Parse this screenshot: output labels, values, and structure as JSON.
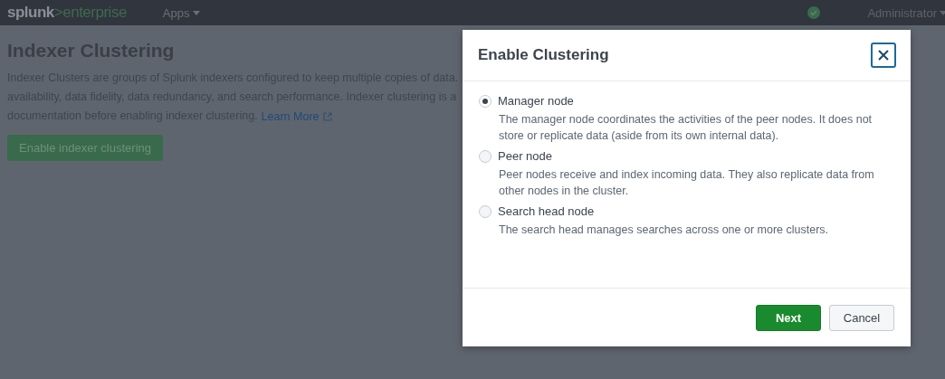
{
  "top_bar": {
    "logo": {
      "brand": "splunk",
      "separator": ">",
      "product": "enterprise"
    },
    "apps_menu": "Apps",
    "healthy": true,
    "user_menu": "Administrator"
  },
  "page": {
    "title": "Indexer Clustering",
    "description_lines": [
      "Indexer Clusters are groups of Splunk indexers configured to keep multiple copies of data.",
      "availability, data fidelity, data redundancy, and search performance. Indexer clustering is a",
      "documentation before enabling indexer clustering."
    ],
    "learn_more_link": "Learn More",
    "enable_button": "Enable indexer clustering"
  },
  "dialog": {
    "title": "Enable Clustering",
    "options": [
      {
        "label": "Manager node",
        "description": "The manager node coordinates the activities of the peer nodes. It does not store or replicate data (aside from its own internal data).",
        "selected": true
      },
      {
        "label": "Peer node",
        "description": "Peer nodes receive and index incoming data. They also replicate data from other nodes in the cluster.",
        "selected": false
      },
      {
        "label": "Search head node",
        "description": "The search head manages searches across one or more clusters.",
        "selected": false
      }
    ],
    "buttons": [
      {
        "kind": "primary",
        "label": "Next"
      },
      {
        "kind": "secondary",
        "label": "Cancel"
      }
    ]
  }
}
